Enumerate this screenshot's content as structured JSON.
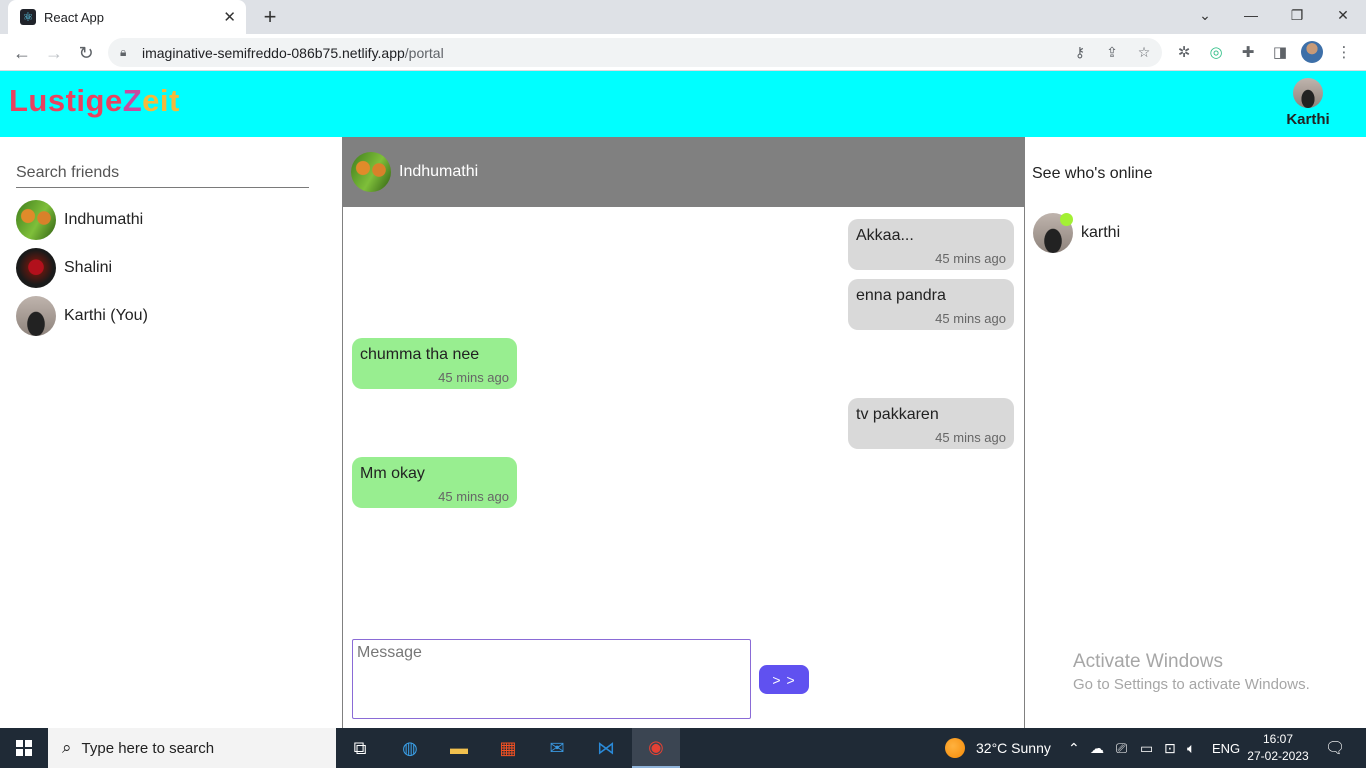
{
  "browser": {
    "tab_title": "React App",
    "new_tab": "+",
    "url_host": "imaginative-semifreddo-086b75.netlify.app",
    "url_path": "/portal"
  },
  "app": {
    "logo": {
      "part1": "Lustige",
      "part2": "Z",
      "part3": "eit"
    },
    "current_user": "Karthi"
  },
  "sidebar": {
    "search_placeholder": "Search friends",
    "friends": [
      {
        "name": "Indhumathi"
      },
      {
        "name": "Shalini"
      },
      {
        "name": "Karthi (You)"
      }
    ]
  },
  "chat": {
    "contact_name": "Indhumathi",
    "messages": [
      {
        "direction": "out",
        "text": "Akkaa...",
        "time": "45 mins ago"
      },
      {
        "direction": "out",
        "text": "enna pandra",
        "time": "45 mins ago"
      },
      {
        "direction": "in",
        "text": "chumma tha nee",
        "time": "45 mins ago"
      },
      {
        "direction": "out",
        "text": "tv pakkaren",
        "time": "45 mins ago"
      },
      {
        "direction": "in",
        "text": "Mm okay",
        "time": "45 mins ago"
      }
    ],
    "input_placeholder": "Message",
    "send_label": "> >"
  },
  "online": {
    "title": "See who's online",
    "users": [
      {
        "name": "karthi"
      }
    ]
  },
  "watermark": {
    "line1": "Activate Windows",
    "line2": "Go to Settings to activate Windows."
  },
  "taskbar": {
    "search_placeholder": "Type here to search",
    "weather": "32°C  Sunny",
    "language": "ENG",
    "time": "16:07",
    "date": "27-02-2023"
  },
  "colors": {
    "header_bg": "#00ffff",
    "chat_header_bg": "#808080",
    "outgoing_bubble": "#d9d9d9",
    "incoming_bubble": "#98ee90",
    "send_button": "#6051f0",
    "online_dot": "#a3f034"
  }
}
